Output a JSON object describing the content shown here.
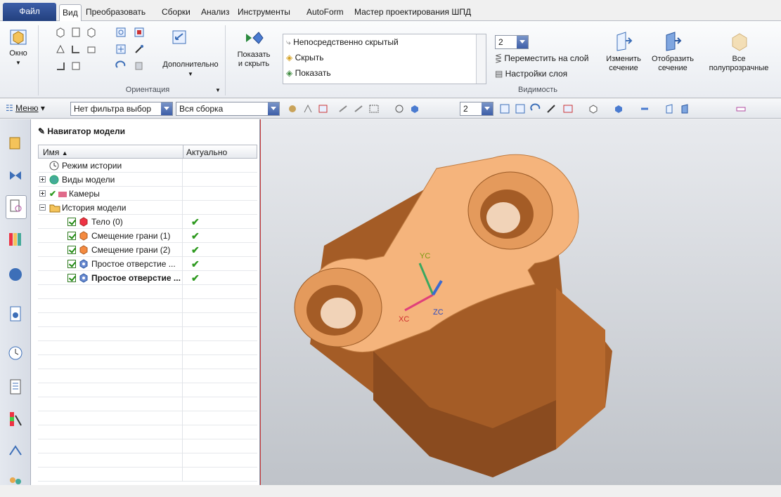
{
  "menu": {
    "file": "Файл",
    "tabs": [
      "Вид",
      "Преобразовать",
      "Сборки",
      "Анализ",
      "Инструменты",
      "AutoForm",
      "Мастер проектирования ШПД"
    ],
    "active": "Вид"
  },
  "ribbon": {
    "window_label": "Окно",
    "orientation_group": "Ориентация",
    "more_label": "Дополнительно",
    "show_hide_label": "Показать\nи скрыть",
    "vis_list": [
      "Непосредственно скрытый",
      "Скрыть",
      "Показать"
    ],
    "layer_value": "2",
    "move_to_layer": "Переместить на слой",
    "layer_settings": "Настройки слоя",
    "visibility_group": "Видимость",
    "edit_section": "Изменить\nсечение",
    "show_section": "Отобразить\nсечение",
    "all_transparent": "Все\nполупрозрачные"
  },
  "toolbar": {
    "menu_label": "Меню",
    "filter_value": "Нет фильтра выбор",
    "assembly_value": "Вся сборка",
    "layer_value": "2"
  },
  "navigator": {
    "title": "Навигатор модели",
    "col_name": "Имя",
    "col_current": "Актуально",
    "rows": [
      {
        "label": "Режим истории",
        "current": false,
        "bold": false
      },
      {
        "label": "Виды модели",
        "current": false,
        "bold": false
      },
      {
        "label": "Камеры",
        "current": false,
        "bold": false
      },
      {
        "label": "История модели",
        "current": false,
        "bold": false
      },
      {
        "label": "Тело (0)",
        "current": true,
        "bold": false
      },
      {
        "label": "Смещение грани (1)",
        "current": true,
        "bold": false
      },
      {
        "label": "Смещение грани (2)",
        "current": true,
        "bold": false
      },
      {
        "label": "Простое отверстие ...",
        "current": true,
        "bold": false
      },
      {
        "label": "Простое отверстие ...",
        "current": true,
        "bold": true
      }
    ]
  },
  "viewport": {
    "axis_x": "XC",
    "axis_y": "YC",
    "axis_z": "ZC"
  },
  "colors": {
    "part_top": "#f5b47c",
    "part_side": "#b0652c",
    "part_dark": "#8a4b1f",
    "accent": "#3d5ea8"
  }
}
